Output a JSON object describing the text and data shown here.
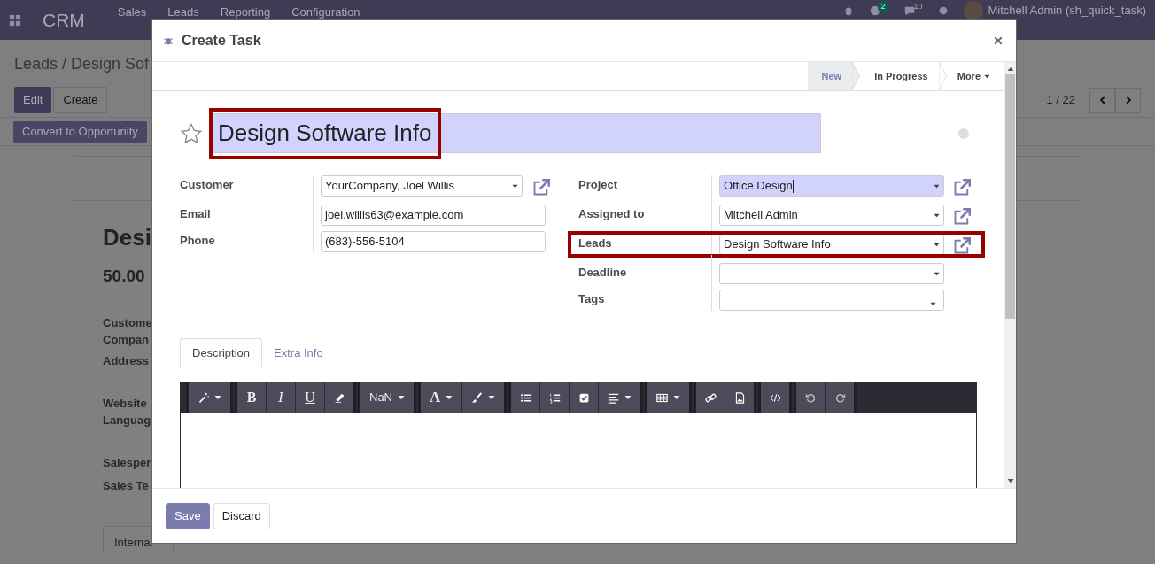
{
  "app_bar": {
    "app_name": "CRM",
    "menu": [
      "Sales",
      "Leads",
      "Reporting",
      "Configuration"
    ],
    "badges": [
      "2",
      "10"
    ],
    "user": "Mitchell Admin (sh_quick_task)"
  },
  "breadcrumb": "Leads / Design Sof",
  "actions": [
    "Edit",
    "Create"
  ],
  "pager": "1 / 22",
  "convert_button": "Convert to Opportunity",
  "record": {
    "title": "Desi",
    "amount": "50.00",
    "labels": [
      "Custome",
      "Compan",
      "Address",
      "Website",
      "Languag",
      "Salesper",
      "Sales Te"
    ],
    "tab": "Internal"
  },
  "dialog": {
    "title": "Create Task",
    "stages": [
      {
        "label": "New",
        "selected": true
      },
      {
        "label": "In Progress",
        "selected": false
      }
    ],
    "more": "More",
    "task_name": {
      "value": "Design Software Info",
      "focused": true,
      "highlighted": true
    },
    "starred": false,
    "left_fields": [
      {
        "label": "Customer",
        "value": "YourCompany, Joel Willis",
        "kind": "select",
        "link": true,
        "focused": false,
        "highlighted": false
      },
      {
        "label": "Email",
        "value": "joel.willis63@example.com",
        "kind": "text",
        "link": false,
        "focused": false,
        "highlighted": false
      },
      {
        "label": "Phone",
        "value": "(683)-556-5104",
        "kind": "text",
        "link": false,
        "focused": false,
        "highlighted": false
      }
    ],
    "right_fields": [
      {
        "label": "Project",
        "value": "Office Design",
        "kind": "select",
        "link": true,
        "focused": true,
        "highlighted": false
      },
      {
        "label": "Assigned to",
        "value": "Mitchell Admin",
        "kind": "select",
        "link": true,
        "focused": false,
        "highlighted": false
      },
      {
        "label": "Leads",
        "value": "Design Software Info",
        "kind": "select",
        "link": true,
        "focused": false,
        "highlighted": true
      },
      {
        "label": "Deadline",
        "kind": "select",
        "link": false,
        "focused": false,
        "highlighted": false
      },
      {
        "label": "Tags",
        "kind": "tags",
        "link": false,
        "focused": false,
        "highlighted": false
      }
    ],
    "tabs": [
      {
        "label": "Description",
        "selected": true
      },
      {
        "label": "Extra Info",
        "selected": false
      }
    ],
    "toolbar": [
      [
        {
          "kind": "magic",
          "dropdown": true
        }
      ],
      [
        {
          "kind": "bold",
          "label": "B"
        },
        {
          "kind": "italic",
          "label": "I"
        },
        {
          "kind": "underline",
          "label": "U"
        },
        {
          "kind": "eraser"
        }
      ],
      [
        {
          "kind": "font-size",
          "label": "NaN",
          "dropdown": true
        }
      ],
      [
        {
          "kind": "font-color",
          "label": "A",
          "dropdown": true
        },
        {
          "kind": "brush",
          "dropdown": true
        }
      ],
      [
        {
          "kind": "list-ul"
        },
        {
          "kind": "list-ol"
        },
        {
          "kind": "checklist"
        },
        {
          "kind": "align",
          "dropdown": true
        }
      ],
      [
        {
          "kind": "table",
          "dropdown": true
        }
      ],
      [
        {
          "kind": "link"
        },
        {
          "kind": "image"
        }
      ],
      [
        {
          "kind": "code"
        }
      ],
      [
        {
          "kind": "undo"
        },
        {
          "kind": "redo"
        }
      ]
    ],
    "buttons": [
      {
        "label": "Save",
        "kind": "primary"
      },
      {
        "label": "Discard",
        "kind": "secondary"
      }
    ]
  }
}
